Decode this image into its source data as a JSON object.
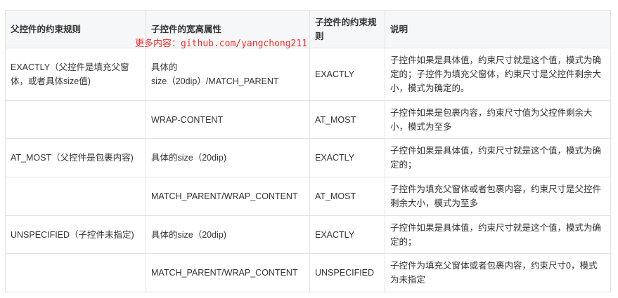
{
  "table": {
    "headers": [
      "父控件的约束规则",
      "子控件的宽高属性",
      "子控件的约束规则",
      "说明"
    ],
    "rows": [
      {
        "parent": "EXACTLY（父控件是填充父窗体，或者具体size值)",
        "child_attr_line1": "具体的",
        "child_attr_line2": "size（20dip）/MATCH_PARENT",
        "child_rule": "EXACTLY",
        "desc": "子控件如果是具体值，约束尺寸就是这个值，模式为确定的；子控件为填充父窗体，约束尺寸是父控件剩余大小，模式为确定的。"
      },
      {
        "parent": "",
        "child_attr": "WRAP-CONTENT",
        "child_rule": "AT_MOST",
        "desc": "子控件如果是包裹内容，约束尺寸值为父控件剩余大小，模式为至多"
      },
      {
        "parent": "AT_MOST（父控件是包裹内容)",
        "child_attr": "具体的size（20dip)",
        "child_rule": "EXACTLY",
        "desc": "子控件如果是具体值，约束尺寸就是这个值，模式为确定的；"
      },
      {
        "parent": "",
        "child_attr": "MATCH_PARENT/WRAP_CONTENT",
        "child_rule": "AT_MOST",
        "desc": "子控件为填充父窗体或者包裹内容，约束尺寸是父控件剩余大小，模式为至多"
      },
      {
        "parent": "UNSPECIFIED（子控件未指定)",
        "child_attr": "具体的size（20dip)",
        "child_rule": "EXACTLY",
        "desc": "子控件如果是具体值，约束尺寸就是这个值，模式为确定的；"
      },
      {
        "parent": "",
        "child_attr": "MATCH_PARENT/WRAP_CONTENT",
        "child_rule": "UNSPECIFIED",
        "desc": "子控件为填充父窗体或者包裹内容，约束尺寸0，模式为未指定"
      }
    ]
  },
  "watermark": {
    "label": "更多内容：",
    "url": "github.com/yangchong211"
  },
  "colors": {
    "header_bg": "#f6f7f8",
    "border": "#e2e2e2",
    "text": "#333333",
    "watermark": "#e8302f"
  }
}
